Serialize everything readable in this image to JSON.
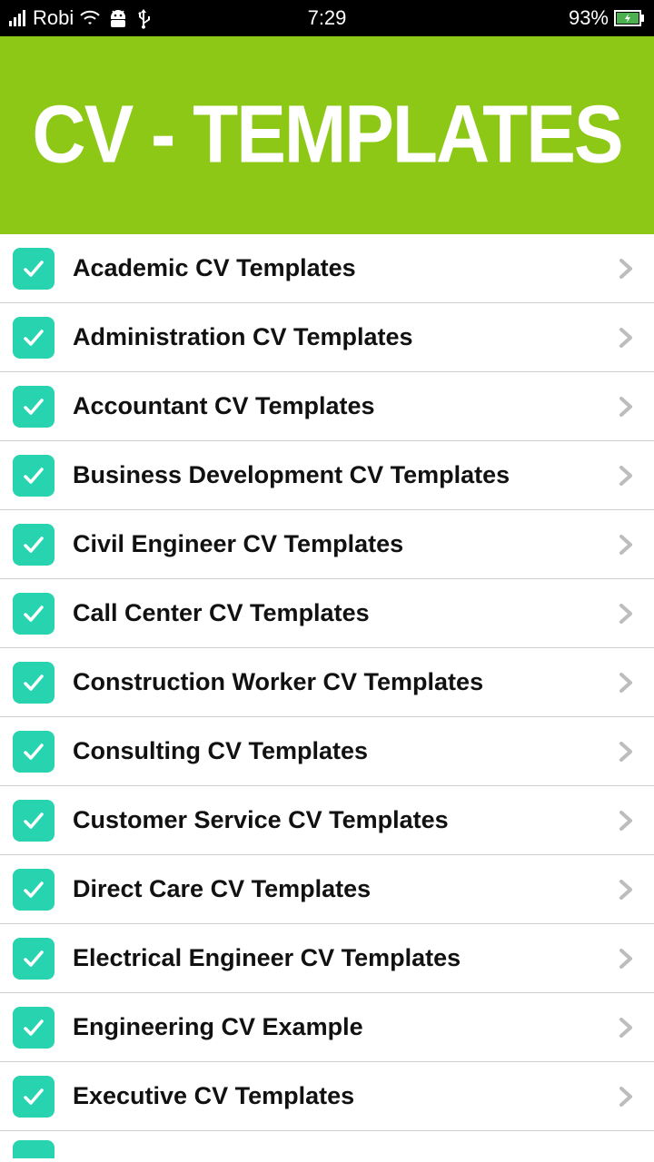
{
  "status": {
    "carrier": "Robi",
    "time": "7:29",
    "battery_pct": "93%"
  },
  "header": {
    "title": "CV - TEMPLATES"
  },
  "list": {
    "items": [
      {
        "label": "Academic CV Templates"
      },
      {
        "label": "Administration CV Templates"
      },
      {
        "label": "Accountant CV Templates"
      },
      {
        "label": "Business Development CV Templates"
      },
      {
        "label": "Civil Engineer CV Templates"
      },
      {
        "label": "Call Center CV Templates"
      },
      {
        "label": "Construction Worker CV Templates"
      },
      {
        "label": "Consulting CV Templates"
      },
      {
        "label": "Customer Service CV Templates"
      },
      {
        "label": "Direct Care CV Templates"
      },
      {
        "label": "Electrical Engineer CV Templates"
      },
      {
        "label": "Engineering CV Example"
      },
      {
        "label": "Executive CV Templates"
      }
    ]
  }
}
